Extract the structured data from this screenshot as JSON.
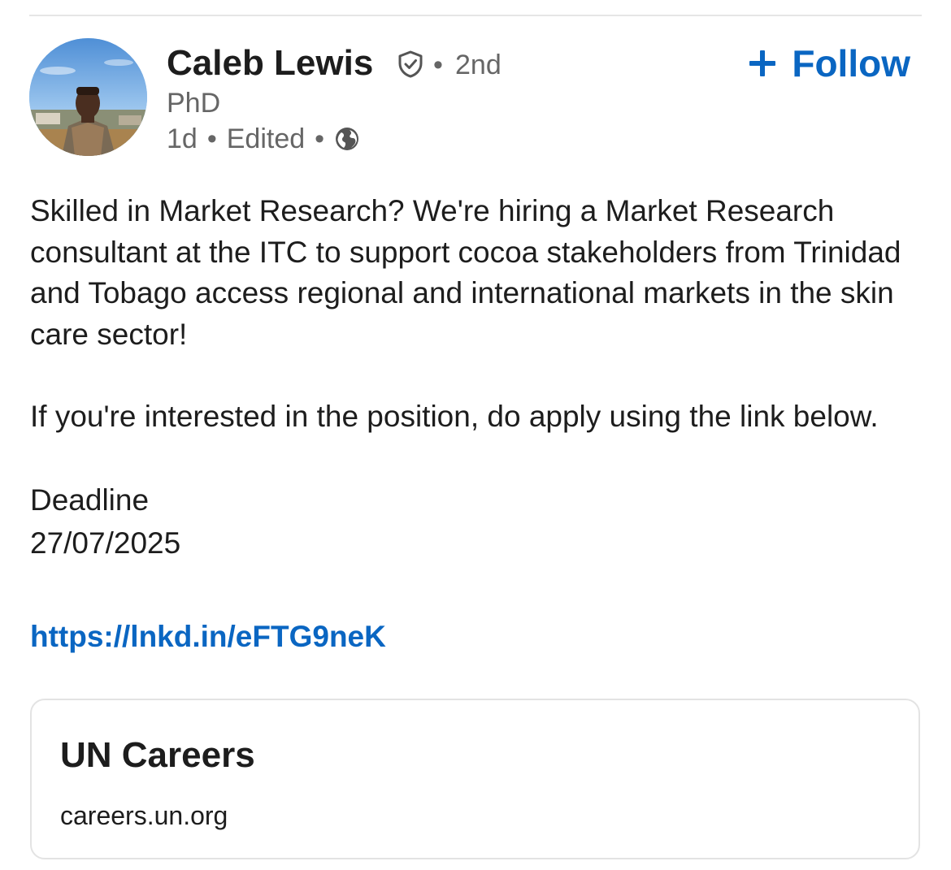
{
  "post": {
    "author": {
      "name": "Caleb Lewis",
      "connection": "2nd",
      "headline": "PhD",
      "posted_ago": "1d",
      "edited_label": "Edited",
      "visibility_icon": "globe-icon",
      "verified_icon": "verified-shield-icon"
    },
    "follow_label": "Follow",
    "body": {
      "paragraph1": "Skilled in Market Research? We're hiring a Market Research consultant at the ITC to support cocoa stakeholders from Trinidad and Tobago access regional and international markets in the skin care sector!",
      "paragraph2": "If you're interested in the position, do apply using the link below.",
      "deadline_label": "Deadline",
      "deadline_date": "27/07/2025",
      "link": "https://lnkd.in/eFTG9neK"
    },
    "link_preview": {
      "title": "UN Careers",
      "domain": "careers.un.org"
    }
  },
  "colors": {
    "accent": "#0a66c2",
    "text_primary": "#1d1d1d",
    "text_secondary": "#666666",
    "divider": "#e6e6e6"
  }
}
